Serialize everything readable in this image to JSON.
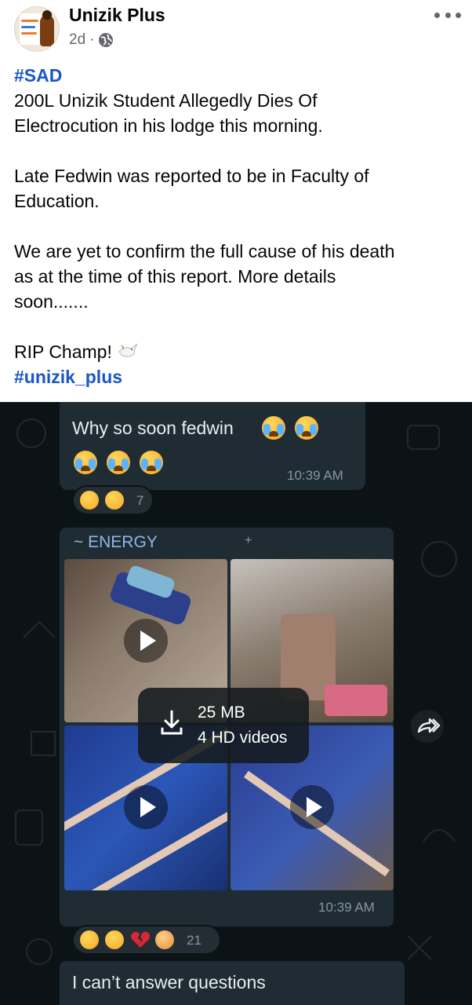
{
  "post": {
    "page_name": "Unizik Plus",
    "time_ago": "2d",
    "separator": "·",
    "privacy_icon": "globe-icon",
    "more_icon": "more-options-icon",
    "hashtag_top": "#SAD",
    "line1": "200L Unizik Student Allegedly Dies Of",
    "line2": "Electrocution in his lodge this morning.",
    "line3": "Late Fedwin was reported to be in Faculty of",
    "line4": "Education.",
    "line5": "We are yet to confirm the full cause of his death",
    "line6": "as at the time of this report. More details",
    "line7": "soon.......",
    "line8": "RIP Champ!",
    "hashtag_bottom": "#unizik_plus"
  },
  "chat": {
    "msg1_text": "Why so soon fedwin",
    "msg1_time": "10:39 AM",
    "msg1_reaction_count": "7",
    "sender_name": "~ ENERGY",
    "download_size": "25 MB",
    "download_count": "4 HD videos",
    "media_time": "10:39 AM",
    "media_reaction_count": "21",
    "msg3_text": "I can’t answer questions"
  },
  "colors": {
    "hashtag": "#1a56c9",
    "chat_background": "#0c1317",
    "bubble": "#1f2c33",
    "sender": "#8fb7e6"
  }
}
